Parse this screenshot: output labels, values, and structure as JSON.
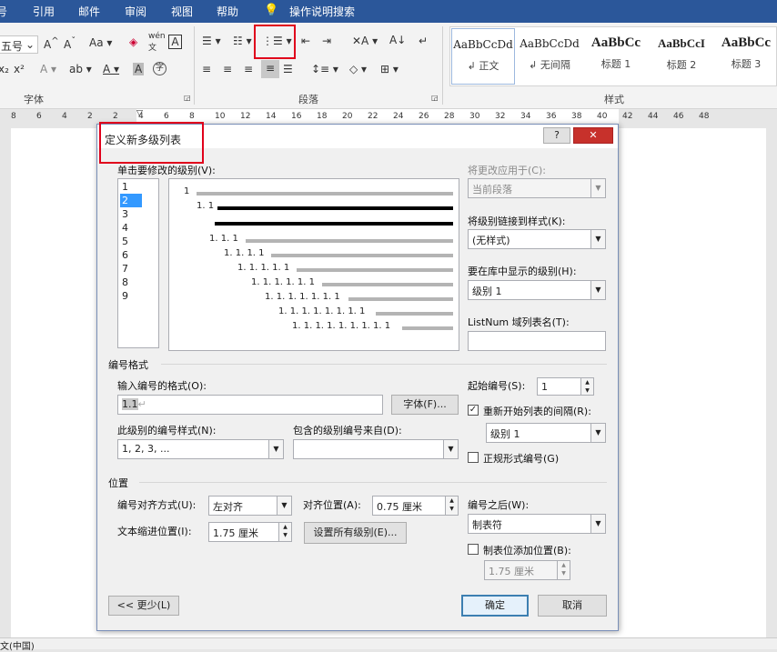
{
  "menubar": {
    "items": [
      "号",
      "引用",
      "邮件",
      "审阅",
      "视图",
      "帮助",
      "操作说明搜索"
    ]
  },
  "ribbon": {
    "font_size_value": "五号",
    "group_font_label": "字体",
    "group_paragraph_label": "段落",
    "group_styles_label": "样式",
    "styles": [
      {
        "preview": "AaBbCcDd",
        "name": "↲ 正文"
      },
      {
        "preview": "AaBbCcDd",
        "name": "↲ 无间隔"
      },
      {
        "preview": "AaBbCc",
        "name": "标题 1"
      },
      {
        "preview": "AaBbCcI",
        "name": "标题 2"
      },
      {
        "preview": "AaBbCc",
        "name": "标题 3"
      }
    ]
  },
  "ruler": {
    "ticks": [
      "8",
      "6",
      "4",
      "2",
      "2",
      "4",
      "6",
      "8",
      "10",
      "12",
      "14",
      "16",
      "18",
      "20",
      "22",
      "24",
      "26",
      "28",
      "30",
      "32",
      "34",
      "36",
      "38",
      "40",
      "42",
      "44",
      "46",
      "48"
    ]
  },
  "status": {
    "language": "文(中国)"
  },
  "dialog": {
    "title": "定义新多级列表",
    "help_icon": "?",
    "close_icon": "✕",
    "level_list_label": "单击要修改的级别(V):",
    "levels": [
      "1",
      "2",
      "3",
      "4",
      "5",
      "6",
      "7",
      "8",
      "9"
    ],
    "selected_level": "2",
    "preview_numbers": [
      "1",
      "1. 1",
      "1. 1. 1",
      "1. 1. 1. 1",
      "1. 1. 1. 1. 1",
      "1. 1. 1. 1. 1. 1",
      "1. 1. 1. 1. 1. 1. 1",
      "1. 1. 1. 1. 1. 1. 1. 1",
      "1. 1. 1. 1. 1. 1. 1. 1. 1"
    ],
    "apply_to_label": "将更改应用于(C):",
    "apply_to_value": "当前段落",
    "link_style_label": "将级别链接到样式(K):",
    "link_style_value": "(无样式)",
    "gallery_level_label": "要在库中显示的级别(H):",
    "gallery_level_value": "级别 1",
    "listnum_label": "ListNum 域列表名(T):",
    "listnum_value": "",
    "number_format_section": "编号格式",
    "enter_format_label": "输入编号的格式(O):",
    "format_value": "1.1",
    "font_button": "字体(F)...",
    "number_style_label": "此级别的编号样式(N):",
    "number_style_value": "1, 2, 3, ...",
    "include_level_label": "包含的级别编号来自(D):",
    "include_level_value": "",
    "start_at_label": "起始编号(S):",
    "start_at_value": "1",
    "restart_label": "重新开始列表的间隔(R):",
    "restart_checked": true,
    "restart_value": "级别 1",
    "legal_label": "正规形式编号(G)",
    "legal_checked": false,
    "position_section": "位置",
    "alignment_label": "编号对齐方式(U):",
    "alignment_value": "左对齐",
    "aligned_at_label": "对齐位置(A):",
    "aligned_at_value": "0.75 厘米",
    "indent_label": "文本缩进位置(I):",
    "indent_value": "1.75 厘米",
    "set_all_button": "设置所有级别(E)...",
    "follow_label": "编号之后(W):",
    "follow_value": "制表符",
    "tab_stop_label": "制表位添加位置(B):",
    "tab_stop_checked": false,
    "tab_stop_value": "1.75 厘米",
    "less_button": "<< 更少(L)",
    "ok_button": "确定",
    "cancel_button": "取消"
  },
  "colors": {
    "menubar": "#2b579a",
    "selection": "#3399ff",
    "highlight_box": "#e0001b"
  }
}
